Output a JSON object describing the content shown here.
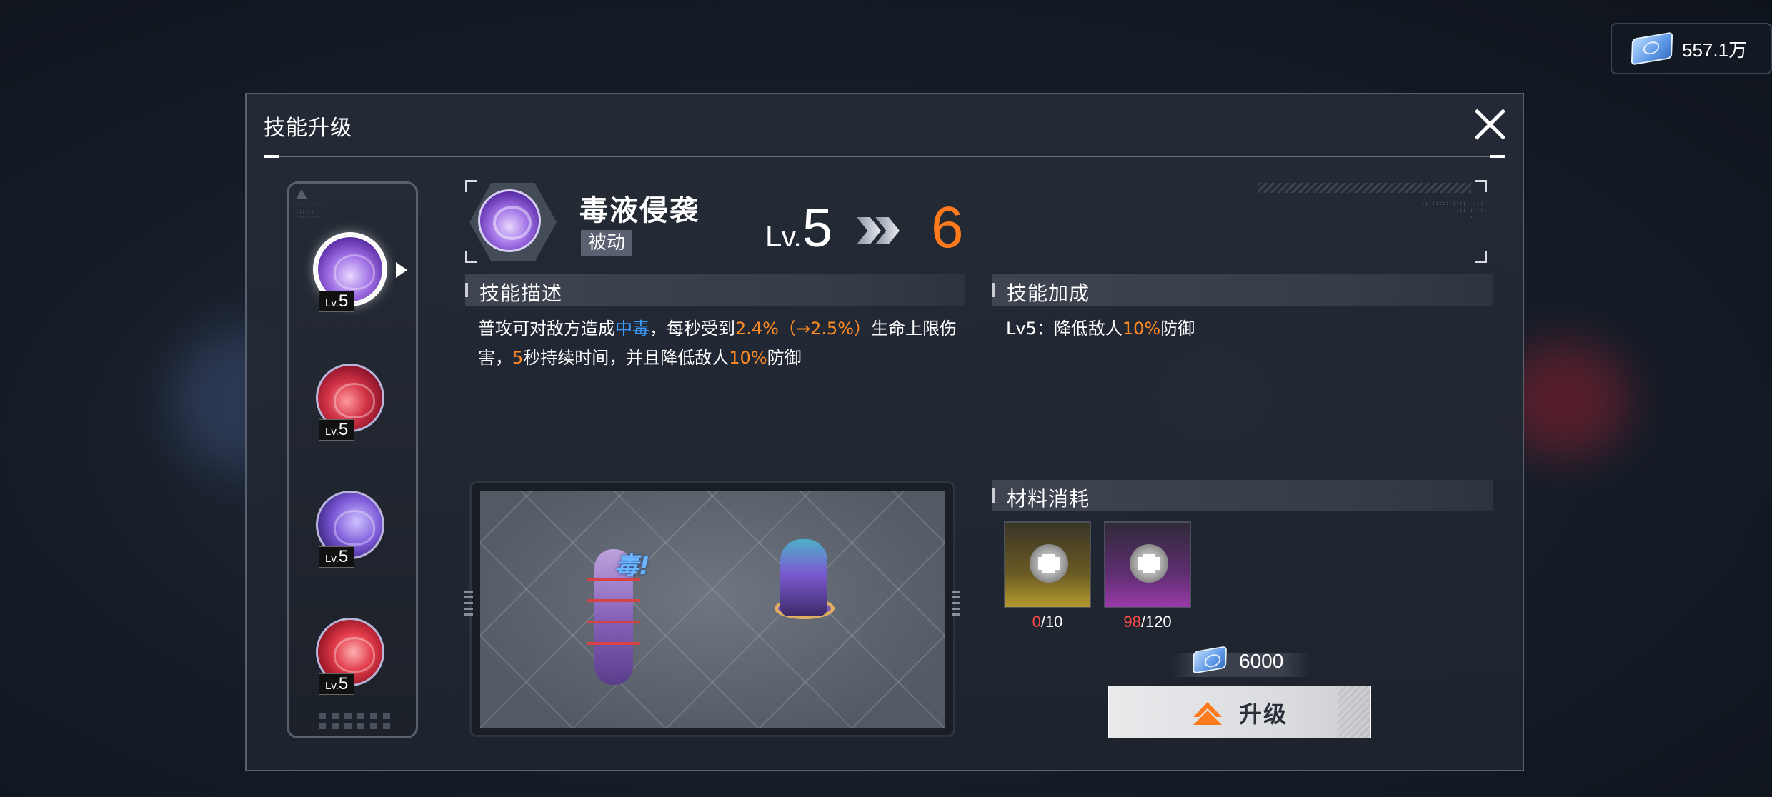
{
  "currency": {
    "amount": "557.1万",
    "icon": "ticket-icon"
  },
  "dialog": {
    "title": "技能升级",
    "close_icon": "close-icon"
  },
  "skill_rail": {
    "items": [
      {
        "level_prefix": "Lv.",
        "level": "5",
        "color": "#8a5ad8",
        "active": true
      },
      {
        "level_prefix": "Lv.",
        "level": "5",
        "color": "#c0283a",
        "active": false
      },
      {
        "level_prefix": "Lv.",
        "level": "5",
        "color": "#6a4ac8",
        "active": false
      },
      {
        "level_prefix": "Lv.",
        "level": "5",
        "color": "#d8323f",
        "active": false
      }
    ]
  },
  "skill": {
    "name": "毒液侵袭",
    "type": "被动",
    "level_prefix": "Lv.",
    "level_current": "5",
    "level_next": "6"
  },
  "description": {
    "header": "技能描述",
    "parts": [
      "普攻可对敌方造成",
      "中毒",
      "，每秒受到",
      "2.4%（→2.5%）",
      "生命上限伤害，",
      "5",
      "秒持续时间，并且降低敌人",
      "10%",
      "防御"
    ]
  },
  "bonus": {
    "header": "技能加成",
    "parts": [
      "Lv5：降低敌人",
      "10%",
      "防御"
    ]
  },
  "preview": {
    "hit_text": "毒!"
  },
  "materials": {
    "header": "材料消耗",
    "items": [
      {
        "owned": "0",
        "required": "/10",
        "tint": "gold"
      },
      {
        "owned": "98",
        "required": "/120",
        "tint": "purple"
      }
    ]
  },
  "cost": {
    "amount": "6000"
  },
  "upgrade_button": {
    "label": "升级"
  },
  "colors": {
    "accent_orange": "#ff7a1c",
    "highlight_blue": "#3b9cff",
    "deficit_red": "#ff4a4a"
  }
}
